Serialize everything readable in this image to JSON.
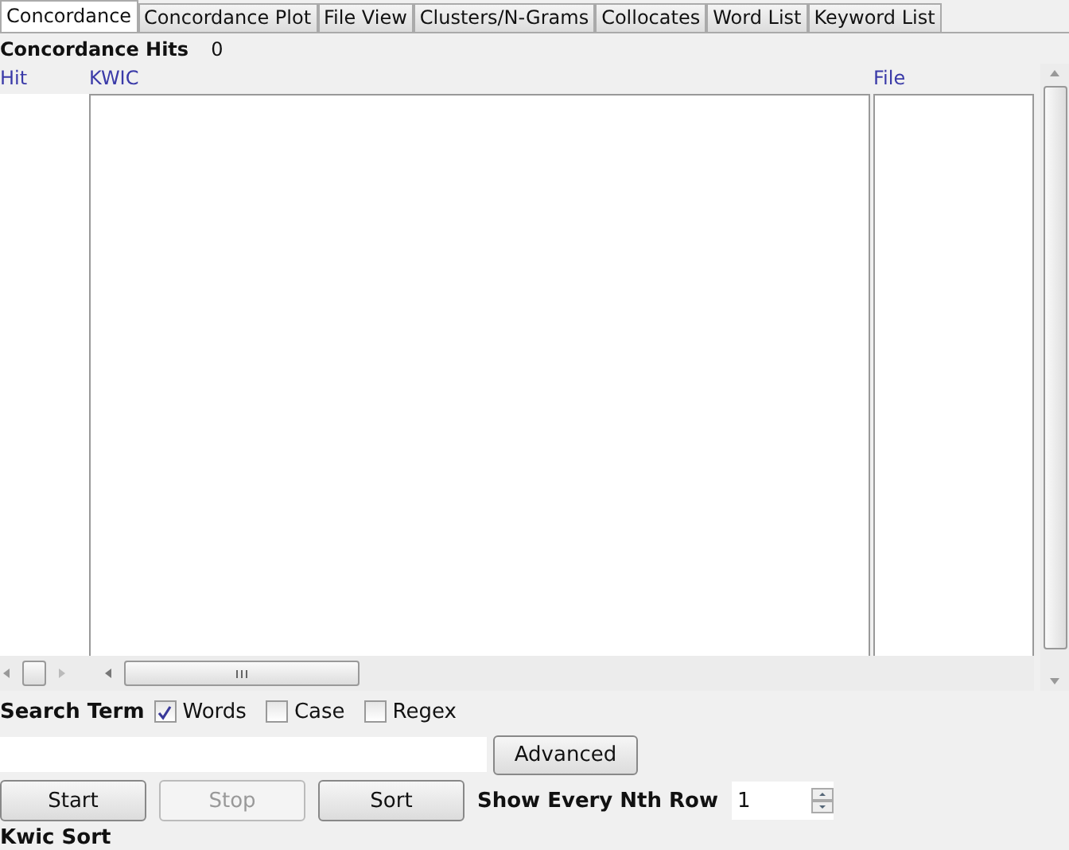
{
  "tabs": [
    {
      "label": "Concordance",
      "selected": true
    },
    {
      "label": "Concordance Plot",
      "selected": false
    },
    {
      "label": "File View",
      "selected": false
    },
    {
      "label": "Clusters/N-Grams",
      "selected": false
    },
    {
      "label": "Collocates",
      "selected": false
    },
    {
      "label": "Word List",
      "selected": false
    },
    {
      "label": "Keyword List",
      "selected": false
    }
  ],
  "hits": {
    "label": "Concordance Hits",
    "count": "0"
  },
  "table": {
    "columns": [
      "Hit",
      "KWIC",
      "File"
    ]
  },
  "search": {
    "label": "Search Term",
    "options": [
      {
        "label": "Words",
        "checked": true
      },
      {
        "label": "Case",
        "checked": false
      },
      {
        "label": "Regex",
        "checked": false
      }
    ],
    "advanced": "Advanced"
  },
  "buttons": [
    {
      "label": "Start",
      "disabled": false
    },
    {
      "label": "Stop",
      "disabled": true
    },
    {
      "label": "Sort",
      "disabled": false
    }
  ],
  "nth_row": {
    "label": "Show Every Nth Row",
    "value": "1"
  },
  "kwic_sort": {
    "label": "Kwic Sort"
  }
}
